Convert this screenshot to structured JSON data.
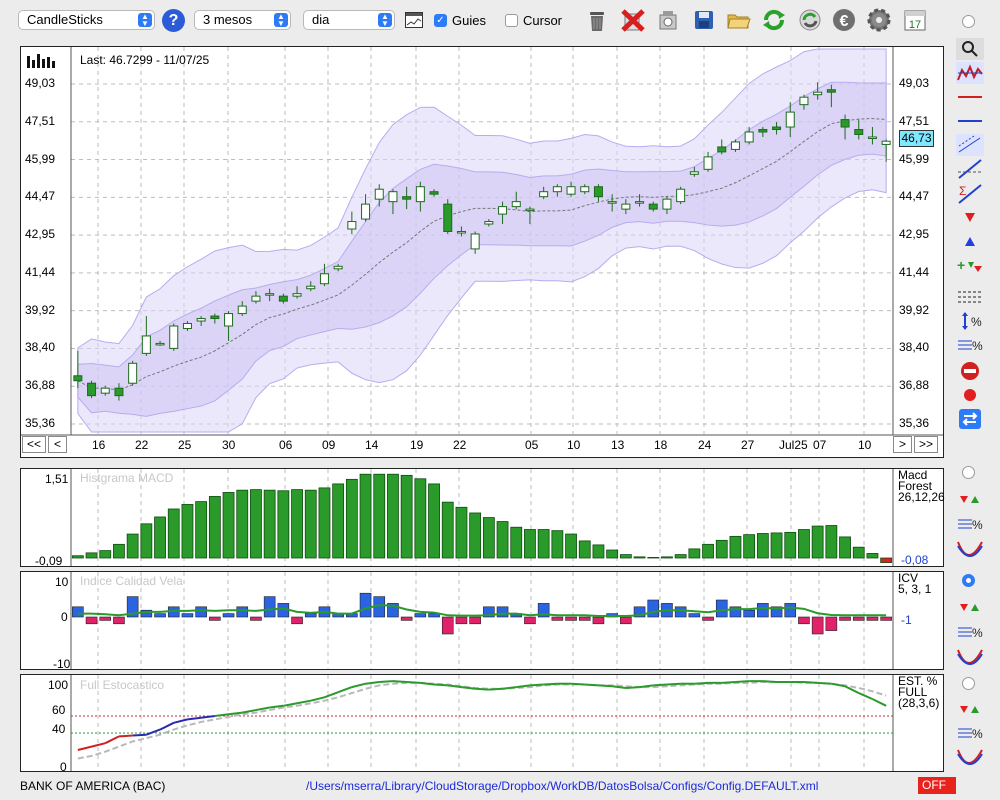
{
  "toolbar": {
    "chart_type": "CandleSticks",
    "period": "3 mesos",
    "interval": "dia",
    "guies_label": "Guies",
    "guies_checked": true,
    "cursor_label": "Cursor",
    "cursor_checked": false,
    "icons": [
      "help-icon",
      "chart-window-icon",
      "trash-icon",
      "delete-icon",
      "history-icon",
      "save-icon",
      "open-folder-icon",
      "refresh-icon",
      "sync-icon",
      "currency-icon",
      "settings-icon",
      "calendar-icon"
    ]
  },
  "main_chart": {
    "last_text": "Last: 46.7299 - 11/07/25",
    "current_price": "46,73",
    "y_ticks": [
      "49,03",
      "47,51",
      "45,99",
      "44,47",
      "42,95",
      "41,44",
      "39,92",
      "38,40",
      "36,88",
      "35,36"
    ],
    "x_labels": [
      "16",
      "22",
      "25",
      "30",
      "06",
      "09",
      "14",
      "19",
      "22",
      "05",
      "10",
      "13",
      "18",
      "24",
      "27",
      "Jul25",
      "07",
      "10"
    ],
    "nav_left": [
      "<<",
      "<"
    ],
    "nav_right": [
      ">",
      ">>"
    ]
  },
  "chart_data": {
    "type": "candlestick",
    "ylim": [
      35.36,
      49.8
    ],
    "candles": [
      [
        37.3,
        37.1,
        38.3,
        36.8
      ],
      [
        37.0,
        36.5,
        37.1,
        36.4
      ],
      [
        36.6,
        36.8,
        36.9,
        36.5
      ],
      [
        36.8,
        36.5,
        37.0,
        36.3
      ],
      [
        37.0,
        37.8,
        37.9,
        36.9
      ],
      [
        38.2,
        38.9,
        39.7,
        38.1
      ],
      [
        38.6,
        38.6,
        38.7,
        38.5
      ],
      [
        38.4,
        39.3,
        39.4,
        38.3
      ],
      [
        39.2,
        39.4,
        39.5,
        39.1
      ],
      [
        39.5,
        39.6,
        39.7,
        39.3
      ],
      [
        39.7,
        39.6,
        39.8,
        39.4
      ],
      [
        39.3,
        39.8,
        39.9,
        38.7
      ],
      [
        39.8,
        40.1,
        40.3,
        39.7
      ],
      [
        40.3,
        40.5,
        40.7,
        40.2
      ],
      [
        40.6,
        40.6,
        40.8,
        40.3
      ],
      [
        40.5,
        40.3,
        40.6,
        40.2
      ],
      [
        40.5,
        40.6,
        40.9,
        40.4
      ],
      [
        40.8,
        40.9,
        41.1,
        40.7
      ],
      [
        41.0,
        41.4,
        41.8,
        40.9
      ],
      [
        41.6,
        41.7,
        41.8,
        41.5
      ],
      [
        43.2,
        43.5,
        43.9,
        43.0
      ],
      [
        43.6,
        44.2,
        44.6,
        43.5
      ],
      [
        44.4,
        44.8,
        45.0,
        44.1
      ],
      [
        44.3,
        44.7,
        44.8,
        43.8
      ],
      [
        44.5,
        44.4,
        44.9,
        44.0
      ],
      [
        44.3,
        44.9,
        45.1,
        43.9
      ],
      [
        44.7,
        44.6,
        44.8,
        44.5
      ],
      [
        44.2,
        43.1,
        44.4,
        43.0
      ],
      [
        43.1,
        43.1,
        43.3,
        42.9
      ],
      [
        42.4,
        43.0,
        43.1,
        42.2
      ],
      [
        43.4,
        43.5,
        43.6,
        43.3
      ],
      [
        43.8,
        44.1,
        44.3,
        43.4
      ],
      [
        44.1,
        44.3,
        44.7,
        44.0
      ],
      [
        44.0,
        44.0,
        44.1,
        43.4
      ],
      [
        44.5,
        44.7,
        44.9,
        44.4
      ],
      [
        44.7,
        44.9,
        45.0,
        44.5
      ],
      [
        44.6,
        44.9,
        45.1,
        44.5
      ],
      [
        44.7,
        44.9,
        45.0,
        44.6
      ],
      [
        44.9,
        44.5,
        45.0,
        44.3
      ],
      [
        44.3,
        44.3,
        44.6,
        43.9
      ],
      [
        44.0,
        44.2,
        44.4,
        43.8
      ],
      [
        44.3,
        44.3,
        44.6,
        44.1
      ],
      [
        44.2,
        44.0,
        44.3,
        43.9
      ],
      [
        44.0,
        44.4,
        44.5,
        43.8
      ],
      [
        44.3,
        44.8,
        44.9,
        44.2
      ],
      [
        45.4,
        45.5,
        45.7,
        45.3
      ],
      [
        45.6,
        46.1,
        46.3,
        45.5
      ],
      [
        46.5,
        46.3,
        46.8,
        46.2
      ],
      [
        46.4,
        46.7,
        46.8,
        46.3
      ],
      [
        46.7,
        47.1,
        47.3,
        46.6
      ],
      [
        47.2,
        47.1,
        47.3,
        46.9
      ],
      [
        47.3,
        47.2,
        47.5,
        47.0
      ],
      [
        47.3,
        47.9,
        48.3,
        46.9
      ],
      [
        48.2,
        48.5,
        48.6,
        48.0
      ],
      [
        48.6,
        48.7,
        49.1,
        48.4
      ],
      [
        48.8,
        48.7,
        49.0,
        48.1
      ],
      [
        47.6,
        47.3,
        47.8,
        46.8
      ],
      [
        47.2,
        47.0,
        47.6,
        46.8
      ],
      [
        46.9,
        46.9,
        47.3,
        46.6
      ],
      [
        46.6,
        46.73,
        46.8,
        45.9
      ]
    ]
  },
  "macd": {
    "title": "Histgrama MACD",
    "y_max": "1,51",
    "y_min": "-0,09",
    "name": "Macd Forest",
    "params": "26,12,26",
    "value": "-0,08"
  },
  "icv": {
    "title": "Indice Calidad Vela",
    "y_max": "10",
    "y_mid": "0",
    "y_min": "-10",
    "name": "ICV",
    "params": "5, 3, 1",
    "value": "-1"
  },
  "stoch": {
    "title": "Full Estocastico",
    "ticks": [
      "100",
      "60",
      "40",
      "0"
    ],
    "name": "EST. %",
    "name2": "FULL",
    "params": "(28,3,6)"
  },
  "status": {
    "symbol": "BANK OF AMERICA (BAC)",
    "path": "/Users/mserra/Library/CloudStorage/Dropbox/WorkDB/DatosBolsa/Configs/Config.DEFAULT.xml",
    "off_label": "OFF"
  },
  "colors": {
    "up_fill": "#ffffff",
    "down_fill": "#2a9a2a",
    "band": "#dcd6f7",
    "macd_bar": "#2a9a2a",
    "icv_pos": "#2b64e0",
    "icv_neg": "#e0226a",
    "off": "#e8231c",
    "path": "#1a2adc"
  }
}
